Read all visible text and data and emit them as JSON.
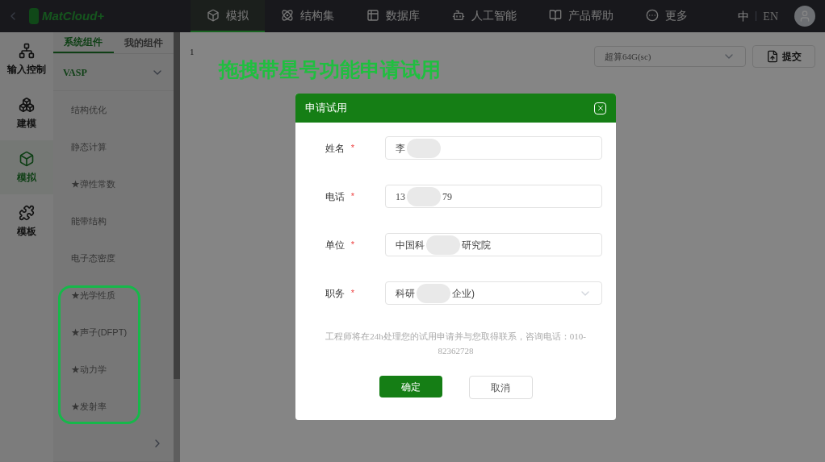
{
  "nav": {
    "logo": "MatCloud+",
    "items": [
      {
        "label": "模拟",
        "selected": true
      },
      {
        "label": "结构集",
        "selected": false
      },
      {
        "label": "数据库",
        "selected": false
      },
      {
        "label": "人工智能",
        "selected": false
      },
      {
        "label": "产品帮助",
        "selected": false
      },
      {
        "label": "更多",
        "selected": false
      }
    ],
    "languages": [
      {
        "label": "中",
        "selected": true
      },
      {
        "label": "EN",
        "selected": false
      }
    ]
  },
  "sidebar": {
    "items": [
      {
        "label": "输入控制",
        "selected": false
      },
      {
        "label": "建模",
        "selected": false
      },
      {
        "label": "模拟",
        "selected": true
      },
      {
        "label": "模板",
        "selected": false
      }
    ]
  },
  "components": {
    "tabs": [
      {
        "label": "系统组件",
        "selected": true
      },
      {
        "label": "我的组件",
        "selected": false
      }
    ],
    "groups": [
      {
        "label": "VASP",
        "expanded": true,
        "items": [
          {
            "label": "结构优化"
          },
          {
            "label": "静态计算"
          },
          {
            "label": "★弹性常数"
          },
          {
            "label": "能带结构"
          },
          {
            "label": "电子态密度"
          },
          {
            "label": "★光学性质"
          },
          {
            "label": "★声子(DFPT)"
          },
          {
            "label": "★动力学"
          },
          {
            "label": "★发射率"
          }
        ]
      },
      {
        "expanded": false
      }
    ]
  },
  "editor": {
    "line_number": "1",
    "annotation": "拖拽带星号功能申请试用",
    "machine_select": "超算64G(sc)",
    "submit_button": "提交"
  },
  "dialog": {
    "title": "申请试用",
    "fields": [
      {
        "label": "姓名",
        "required_mark": "*",
        "kind": "input",
        "value_start": "李"
      },
      {
        "label": "电话",
        "required_mark": "*",
        "kind": "input",
        "value_start": "13",
        "value_end": "79"
      },
      {
        "label": "单位",
        "required_mark": "*",
        "kind": "input",
        "value_start": "中国科",
        "value_end": "研究院"
      },
      {
        "label": "职务",
        "required_mark": "*",
        "kind": "select",
        "value_start": "科研",
        "value_end": "企业)"
      }
    ],
    "note": "工程师将在24h处理您的试用申请并与您取得联系，咨询电话：010-82362728",
    "confirm_button": "确定",
    "cancel_button": "取消"
  }
}
